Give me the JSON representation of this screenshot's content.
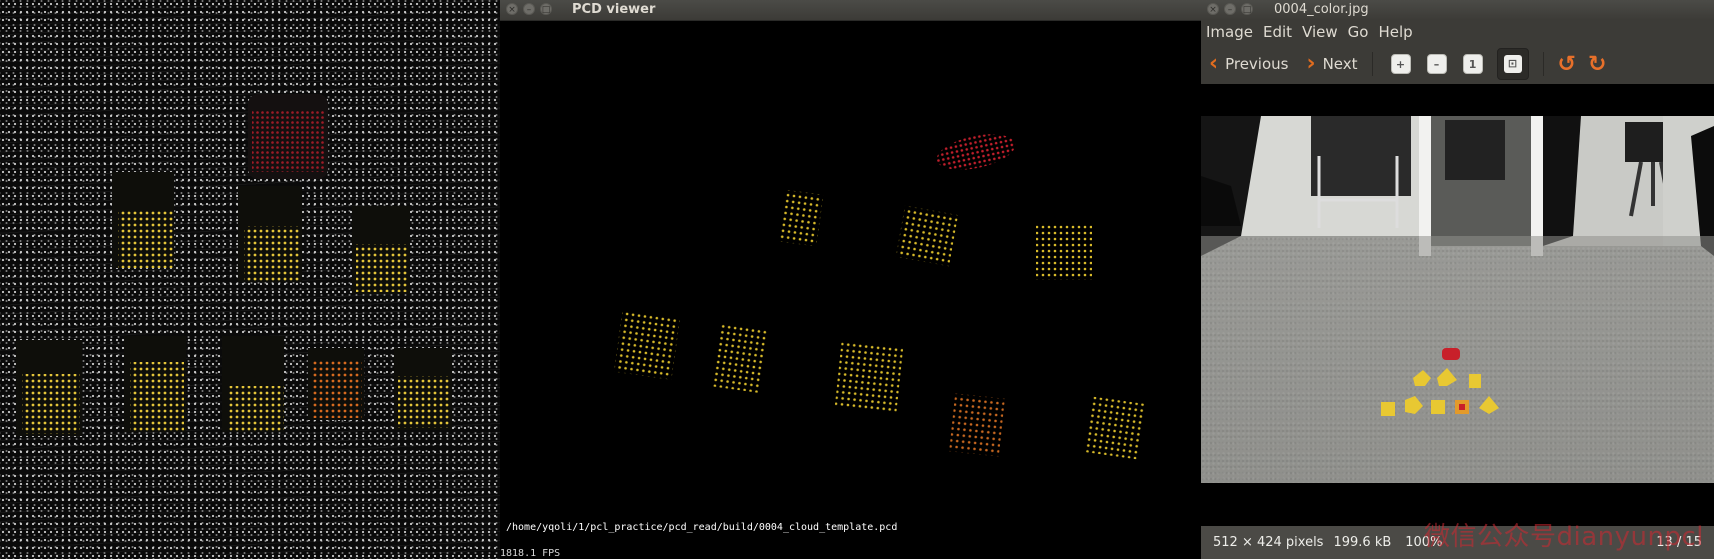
{
  "pcd_viewer": {
    "title": "PCD viewer",
    "window_buttons": [
      "×",
      "–",
      "□"
    ],
    "file_path": "/home/yqoli/1/pcl_practice/pcd_read/build/0004_cloud_template.pcd",
    "fps": "1818.1 FPS"
  },
  "image_viewer": {
    "title": "0004_color.jpg",
    "window_buttons": [
      "×",
      "–",
      "□"
    ],
    "menu": [
      "Image",
      "Edit",
      "View",
      "Go",
      "Help"
    ],
    "toolbar": {
      "previous_label": "Previous",
      "next_label": "Next",
      "zoom_in_icon": "+",
      "zoom_out_icon": "–",
      "normal_size_icon": "1",
      "best_fit_icon": "⊡"
    },
    "status": {
      "dimensions": "512 × 424 pixels",
      "file_size": "199.6 kB",
      "zoom": "100%",
      "position": "13 / 15"
    },
    "watermark": "微信公众号dianyunpcl"
  },
  "colors": {
    "accent_orange": "#e06c1f",
    "titlebar": "#3c3b37",
    "object_yellow": "#e8c832",
    "object_red": "#c8202a"
  }
}
